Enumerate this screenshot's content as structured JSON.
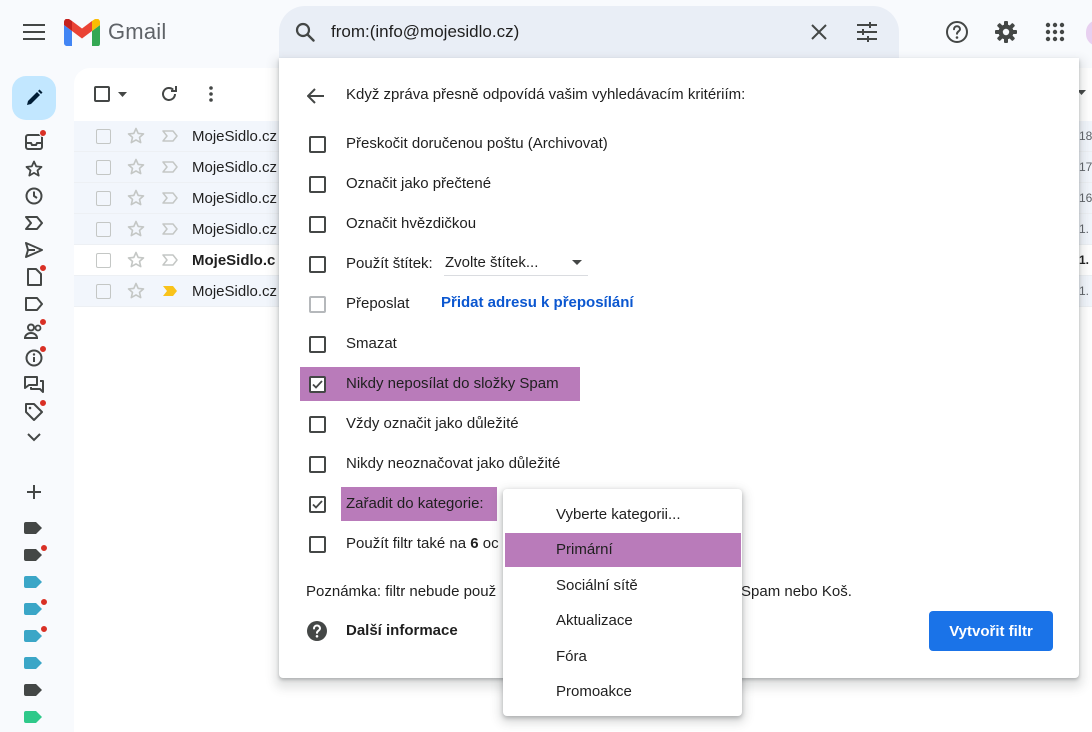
{
  "app": {
    "name": "Gmail"
  },
  "search": {
    "query": "from:(info@mojesidlo.cz)"
  },
  "mail_list": {
    "rows": [
      {
        "sender": "MojeSidlo.cz",
        "date": "18",
        "unread": false,
        "important": false
      },
      {
        "sender": "MojeSidlo.cz",
        "date": "17",
        "unread": false,
        "important": false
      },
      {
        "sender": "MojeSidlo.cz",
        "date": "16",
        "unread": false,
        "important": false
      },
      {
        "sender": "MojeSidlo.cz",
        "date": "1.",
        "unread": false,
        "important": false
      },
      {
        "sender": "MojeSidlo.c",
        "date": "1.",
        "unread": true,
        "important": false
      },
      {
        "sender": "MojeSidlo.cz",
        "date": "1.",
        "unread": false,
        "important": true
      }
    ]
  },
  "filter_dialog": {
    "heading": "Když zpráva přesně odpovídá vašim vyhledávacím kritériím:",
    "options": [
      {
        "label": "Přeskočit doručenou poštu (Archivovat)",
        "checked": false,
        "disabled": false,
        "highlight": false
      },
      {
        "label": "Označit jako přečtené",
        "checked": false,
        "disabled": false,
        "highlight": false
      },
      {
        "label": "Označit hvězdičkou",
        "checked": false,
        "disabled": false,
        "highlight": false
      },
      {
        "label": "Použít štítek:",
        "checked": false,
        "disabled": false,
        "highlight": false
      },
      {
        "label": "Přeposlat",
        "checked": false,
        "disabled": true,
        "highlight": false
      },
      {
        "label": "Smazat",
        "checked": false,
        "disabled": false,
        "highlight": false
      },
      {
        "label": "Nikdy neposílat do složky Spam",
        "checked": true,
        "disabled": false,
        "highlight": true
      },
      {
        "label": "Vždy označit jako důležité",
        "checked": false,
        "disabled": false,
        "highlight": false
      },
      {
        "label": "Nikdy neoznačovat jako důležité",
        "checked": false,
        "disabled": false,
        "highlight": false
      },
      {
        "label": "Zařadit do kategorie:",
        "checked": true,
        "disabled": false,
        "highlight": true
      },
      {
        "label_prefix": "Použít filtr také na ",
        "label_bold": "6",
        "label_suffix": " oc",
        "checked": false,
        "disabled": false,
        "highlight": false
      }
    ],
    "label_select": {
      "value": "Zvolte štítek..."
    },
    "forward_link": "Přidat adresu k přeposílání",
    "note_start": "Poznámka: filtr nebude použ",
    "note_end": "Spam nebo Koš.",
    "help_link": "Další informace",
    "create_button": "Vytvořit filtr"
  },
  "category_dropdown": {
    "items": [
      {
        "label": "Vyberte kategorii...",
        "selected": false
      },
      {
        "label": "Primární",
        "selected": true
      },
      {
        "label": "Sociální sítě",
        "selected": false
      },
      {
        "label": "Aktualizace",
        "selected": false
      },
      {
        "label": "Fóra",
        "selected": false
      },
      {
        "label": "Promoakce",
        "selected": false
      }
    ]
  },
  "colors": {
    "highlight": "#b97bba",
    "primary_button": "#1a73e8",
    "link": "#0b57d0",
    "compose": "#c2e7ff",
    "notification_dot": "#d93025"
  }
}
